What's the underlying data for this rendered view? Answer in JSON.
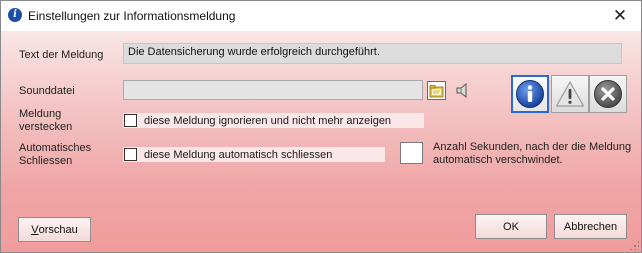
{
  "window": {
    "title": "Einstellungen zur Informationsmeldung",
    "close_glyph": "✕",
    "app_icon_glyph": "i"
  },
  "form": {
    "message_label": "Text der Meldung",
    "message_value": "Die Datensicherung wurde erfolgreich durchgeführt.",
    "sound_label": "Sounddatei",
    "sound_value": "",
    "hide_label_line1": "Meldung",
    "hide_label_line2": "verstecken",
    "hide_checkbox_label": "diese Meldung ignorieren und nicht mehr anzeigen",
    "hide_checked": false,
    "autoclose_label_line1": "Automatisches",
    "autoclose_label_line2": "Schliessen",
    "autoclose_checkbox_label": "diese Meldung automatisch schliessen",
    "autoclose_checked": false,
    "seconds_value": "",
    "seconds_hint_line1": "Anzahl Sekunden, nach der die Meldung",
    "seconds_hint_line2": "automatisch verschwindet."
  },
  "message_types": [
    {
      "name": "info",
      "icon": "info-icon",
      "selected": true
    },
    {
      "name": "warning",
      "icon": "warning-icon",
      "selected": false
    },
    {
      "name": "error",
      "icon": "error-icon",
      "selected": false
    }
  ],
  "buttons": {
    "preview_underlined": "V",
    "preview_rest": "orschau",
    "ok": "OK",
    "cancel": "Abbrechen"
  },
  "colors": {
    "info_blue": "#1d4fa8",
    "selection_border": "#2a6ad8",
    "background_top": "#f9e6e6",
    "background_bottom": "#f19c9c"
  }
}
